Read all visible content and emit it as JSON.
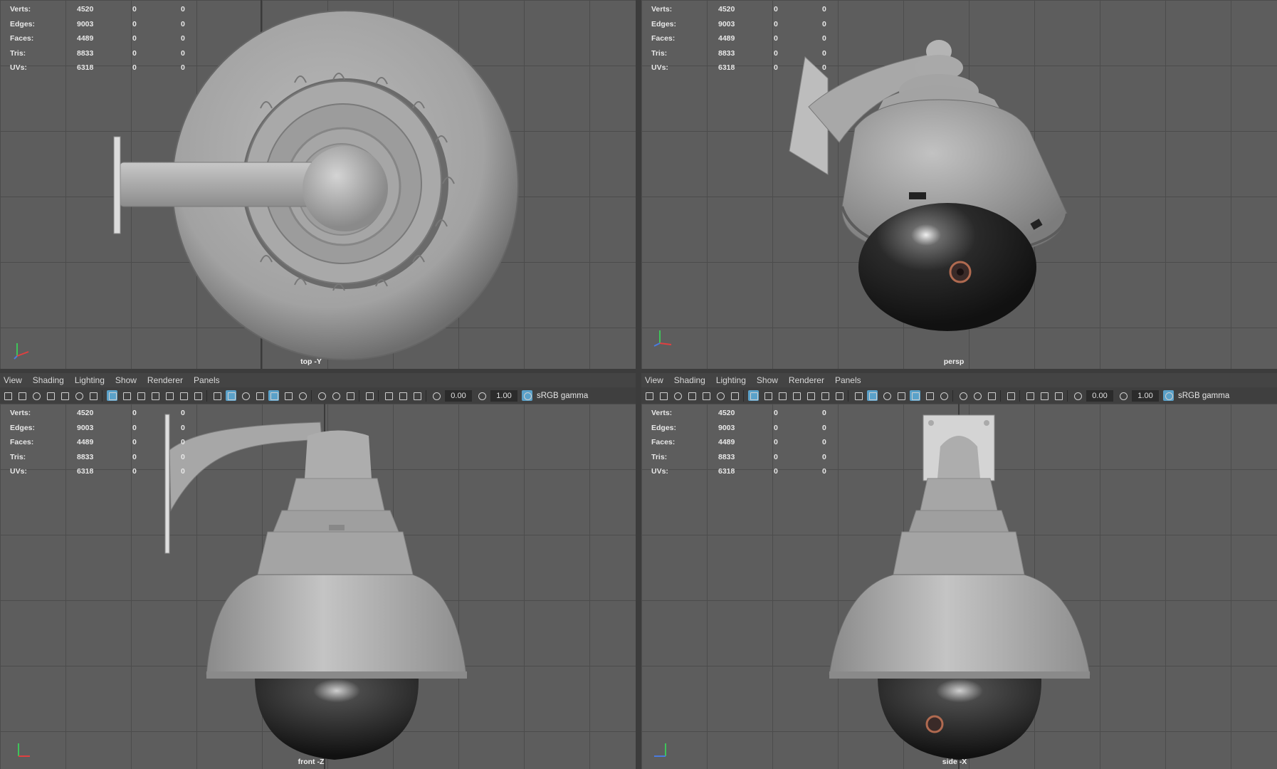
{
  "stats_labels": [
    "Verts:",
    "Edges:",
    "Faces:",
    "Tris:",
    "UVs:"
  ],
  "stats_values": [
    [
      "4520",
      "0",
      "0"
    ],
    [
      "9003",
      "0",
      "0"
    ],
    [
      "4489",
      "0",
      "0"
    ],
    [
      "8833",
      "0",
      "0"
    ],
    [
      "6318",
      "0",
      "0"
    ]
  ],
  "viewports": {
    "top": {
      "camera": "top -Y"
    },
    "persp": {
      "camera": "persp"
    },
    "front": {
      "camera": "front -Z"
    },
    "side": {
      "camera": "side -X"
    }
  },
  "menus": [
    "View",
    "Shading",
    "Lighting",
    "Show",
    "Renderer",
    "Panels"
  ],
  "toolbar": {
    "exposure": "0.00",
    "gamma": "1.00",
    "color_space": "sRGB gamma"
  },
  "colors": {
    "viewport_bg": "#5d5d5d",
    "grid": "#4c4c4c",
    "active_icon": "#5aa1c9",
    "ui_bg": "#444444"
  }
}
